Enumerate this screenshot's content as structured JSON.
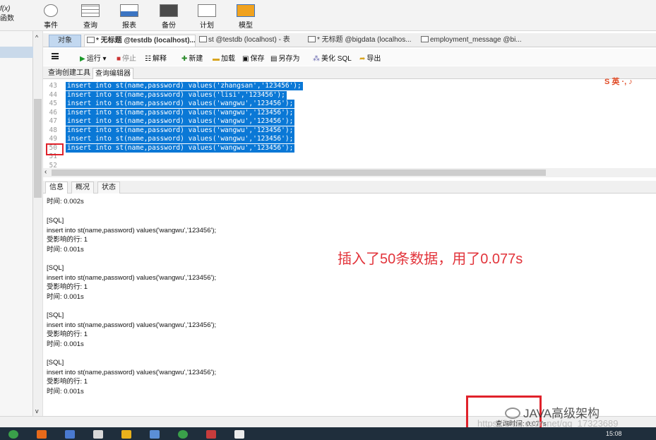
{
  "colors": {
    "selection": "#0a78d6",
    "annotation": "#e2343b",
    "highlight_box": "#e0222b"
  },
  "top_toolbar": {
    "left_cut": [
      "f(x)",
      "函数"
    ],
    "items": [
      {
        "label": "事件",
        "icon": "event-icon"
      },
      {
        "label": "查询",
        "icon": "query-grid-icon"
      },
      {
        "label": "报表",
        "icon": "report-icon"
      },
      {
        "label": "备份",
        "icon": "backup-icon"
      },
      {
        "label": "计划",
        "icon": "schedule-icon"
      },
      {
        "label": "模型",
        "icon": "model-icon"
      }
    ]
  },
  "doc_tabs": [
    {
      "label": "对象"
    },
    {
      "label": "* 无标题 @testdb (localhost)..."
    },
    {
      "label": "st @testdb (localhost) - 表"
    },
    {
      "label": "* 无标题 @bigdata (localhos..."
    },
    {
      "label": "employment_message @bi..."
    }
  ],
  "query_toolbar": {
    "run": "运行",
    "stop": "停止",
    "explain": "解释",
    "new": "新建",
    "load": "加载",
    "save": "保存",
    "save_as": "另存为",
    "beautify": "美化 SQL",
    "export": "导出"
  },
  "sub_tabs": [
    "查询创建工具",
    "查询编辑器"
  ],
  "editor": {
    "lines": [
      {
        "n": "43",
        "code": "insert into st(name,password) values('zhangsan','123456');",
        "sel": true
      },
      {
        "n": "44",
        "code": "insert into st(name,password) values('lisi','123456');",
        "sel": true
      },
      {
        "n": "45",
        "code": "insert into st(name,password) values('wangwu','123456');",
        "sel": true
      },
      {
        "n": "46",
        "code": "insert into st(name,password) values('wangwu','123456');",
        "sel": true
      },
      {
        "n": "47",
        "code": "insert into st(name,password) values('wangwu','123456');",
        "sel": true
      },
      {
        "n": "48",
        "code": "insert into st(name,password) values('wangwu','123456');",
        "sel": true
      },
      {
        "n": "49",
        "code": "insert into st(name,password) values('wangwu','123456');",
        "sel": true
      },
      {
        "n": "50",
        "code": "insert into st(name,password) values('wangwu','123456');",
        "sel": true
      },
      {
        "n": "51",
        "code": "",
        "sel": false
      },
      {
        "n": "52",
        "code": "",
        "sel": false
      }
    ]
  },
  "ime_badge": "S 英 ·, ♪",
  "result_tabs": [
    "信息",
    "概况",
    "状态"
  ],
  "messages": {
    "first_time": "时间: 0.002s",
    "blocks": [
      {
        "tag": "[SQL]",
        "sql": "insert into st(name,password) values('wangwu','123456');",
        "rows": "受影响的行: 1",
        "time": "时间: 0.001s"
      },
      {
        "tag": "[SQL]",
        "sql": "insert into st(name,password) values('wangwu','123456');",
        "rows": "受影响的行: 1",
        "time": "时间: 0.001s"
      },
      {
        "tag": "[SQL]",
        "sql": "insert into st(name,password) values('wangwu','123456');",
        "rows": "受影响的行: 1",
        "time": "时间: 0.001s"
      },
      {
        "tag": "[SQL]",
        "sql": "insert into st(name,password) values('wangwu','123456');",
        "rows": "受影响的行: 1",
        "time": "时间: 0.001s"
      }
    ]
  },
  "annotation": "插入了50条数据，用了0.077s",
  "status": {
    "query_time": "查询时间: 0.077s"
  },
  "watermark": {
    "text": "JAVA高级架构",
    "url": "https://blog.csdn.net/qq_17323689"
  },
  "taskbar": {
    "clock": "15:08"
  }
}
